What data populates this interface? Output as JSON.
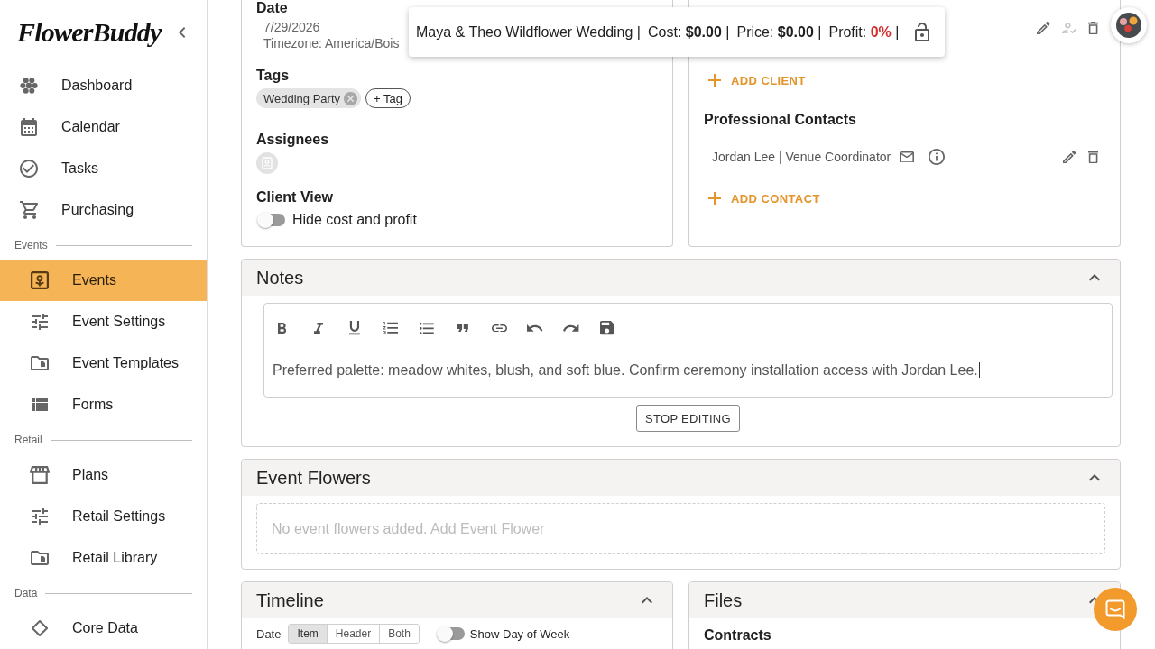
{
  "sidebar": {
    "logo": "FlowerBuddy",
    "sections": [
      {
        "items": [
          {
            "label": "Dashboard",
            "selected": false
          },
          {
            "label": "Calendar",
            "selected": false
          },
          {
            "label": "Tasks",
            "selected": false
          },
          {
            "label": "Purchasing",
            "selected": false
          }
        ]
      },
      {
        "heading": "Events",
        "items": [
          {
            "label": "Events",
            "selected": true
          },
          {
            "label": "Event Settings",
            "selected": false
          },
          {
            "label": "Event Templates",
            "selected": false
          },
          {
            "label": "Forms",
            "selected": false
          }
        ]
      },
      {
        "heading": "Retail",
        "items": [
          {
            "label": "Plans",
            "selected": false
          },
          {
            "label": "Retail Settings",
            "selected": false
          },
          {
            "label": "Retail Library",
            "selected": false
          }
        ]
      },
      {
        "heading": "Data",
        "items": [
          {
            "label": "Core Data",
            "selected": false
          }
        ]
      }
    ]
  },
  "summary_bar": {
    "title": "Maya & Theo Wildflower Wedding |",
    "figures": [
      {
        "label": "Cost:",
        "value": "$0.00",
        "separator": "|",
        "color": "#212121"
      },
      {
        "label": "Price:",
        "value": "$0.00",
        "separator": "|",
        "color": "#212121"
      },
      {
        "label": "Profit:",
        "value": "0%",
        "separator": "|",
        "color": "#d32f2f"
      }
    ],
    "locked": false
  },
  "details_card": {
    "date_label": "Date",
    "date": "7/29/2026",
    "timezone": "Timezone: America/Bois",
    "tags_label": "Tags",
    "tags": [
      {
        "label": "Wedding Party"
      }
    ],
    "add_tag": "+ Tag",
    "assignees_label": "Assignees",
    "client_view_label": "Client View",
    "hide_cost_toggle": {
      "label": "Hide cost and profit",
      "on": false
    }
  },
  "clients_card": {
    "client_actions": [
      {
        "kind": "edit",
        "disabled": false
      },
      {
        "kind": "assign",
        "disabled": true
      },
      {
        "kind": "delete",
        "disabled": false
      }
    ],
    "add_client": "ADD CLIENT",
    "contacts_heading": "Professional Contacts",
    "contacts": [
      {
        "text": "Jordan Lee | Venue Coordinator"
      }
    ],
    "add_contact": "ADD CONTACT"
  },
  "notes": {
    "title": "Notes",
    "expanded": true,
    "text": "Preferred palette: meadow whites, blush, and soft blue. Confirm ceremony installation access with Jordan Lee.",
    "stop_editing": "STOP EDITING"
  },
  "event_flowers": {
    "title": "Event Flowers",
    "expanded": true,
    "empty_text": "No event flowers added.",
    "add_link": "Add Event Flower"
  },
  "timeline": {
    "title": "Timeline",
    "expanded": true,
    "date_label": "Date",
    "modes": [
      {
        "label": "Item",
        "selected": true
      },
      {
        "label": "Header",
        "selected": false
      },
      {
        "label": "Both",
        "selected": false
      }
    ],
    "day_of_week_toggle": {
      "label": "Show Day of Week",
      "on": false
    }
  },
  "files": {
    "title": "Files",
    "expanded": true,
    "section": "Contracts"
  }
}
